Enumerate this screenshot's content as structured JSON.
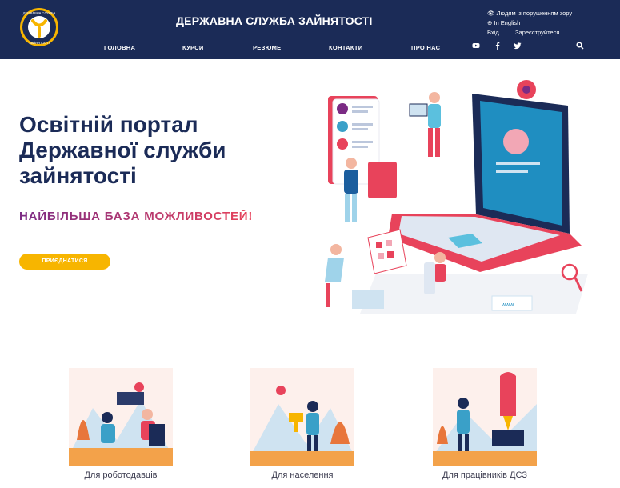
{
  "header": {
    "title": "ДЕРЖАВНА СЛУЖБА ЗАЙНЯТОСТІ",
    "logo_text": "ДЕРЖАВНА СЛУЖБА ЗАЙНЯТОСТІ",
    "accessibility_link": "Людям із порушенням зору",
    "language_link": "In English",
    "login_link": "Вхід",
    "register_link": "Зареєструйтеся",
    "nav": [
      "ГОЛОВНА",
      "КУРСИ",
      "РЕЗЮМЕ",
      "КОНТАКТИ",
      "ПРО НАС"
    ],
    "social_icons": [
      "youtube-icon",
      "facebook-icon",
      "twitter-icon"
    ],
    "search_icon": "search-icon"
  },
  "hero": {
    "title": "Освітній портал Державної служби зайнятості",
    "tagline": "НАЙБІЛЬША БАЗА МОЖЛИВОСТЕЙ!",
    "button": "ПРИЄДНАТИСЯ",
    "laptop_screen_text": "www"
  },
  "cards": [
    {
      "label": "Для роботодавців"
    },
    {
      "label": "Для населення"
    },
    {
      "label": "Для працівників ДСЗ"
    }
  ],
  "colors": {
    "header_bg": "#1b2b57",
    "accent": "#f7b500",
    "title": "#1b2b57",
    "tagline_start": "#7b2b84",
    "tagline_end": "#e8435b"
  }
}
